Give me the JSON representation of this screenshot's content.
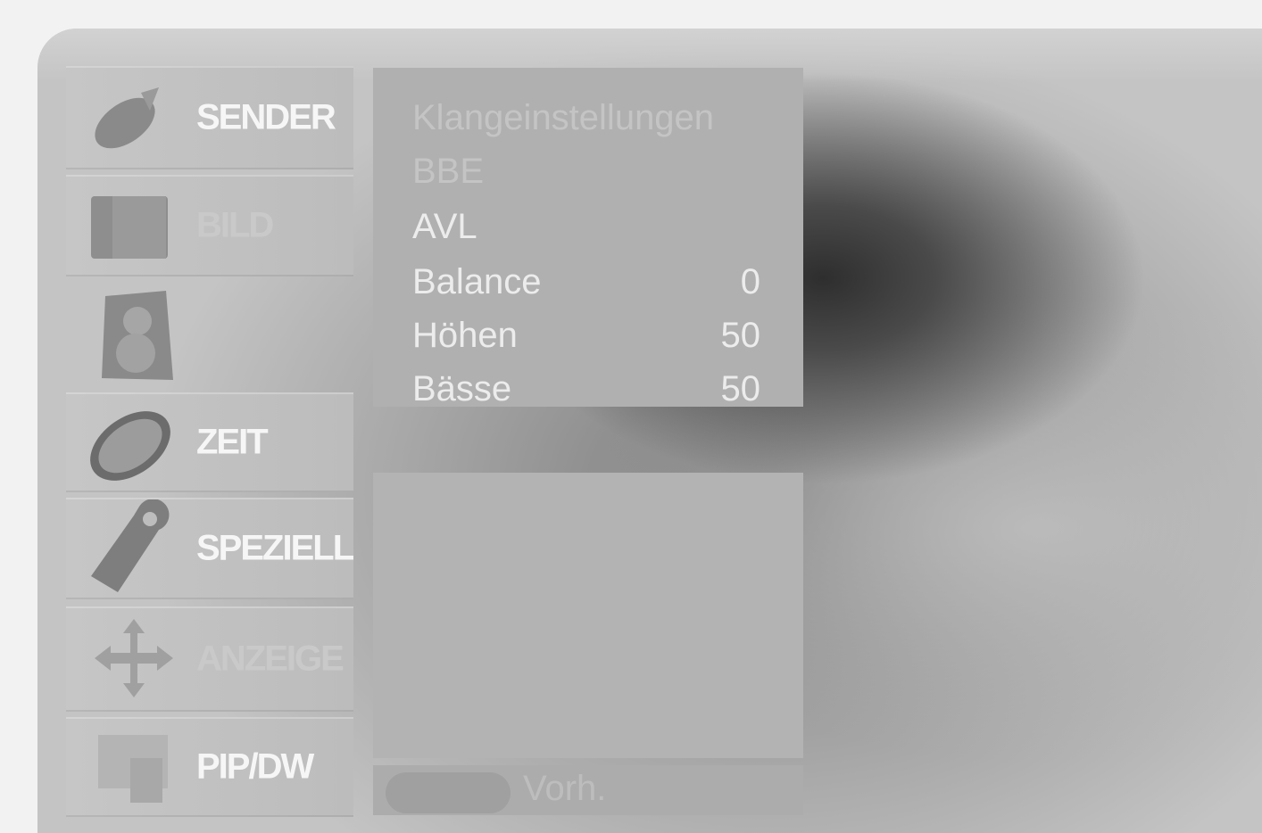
{
  "sidebar": {
    "items": [
      {
        "label": "SENDER",
        "icon": "satellite-dish-icon"
      },
      {
        "label": "BILD",
        "icon": "screen-icon"
      },
      {
        "label": "",
        "icon": "speaker-icon"
      },
      {
        "label": "ZEIT",
        "icon": "clock-icon"
      },
      {
        "label": "SPEZIELL",
        "icon": "tag-icon"
      },
      {
        "label": "ANZEIGE",
        "icon": "move-arrows-icon"
      },
      {
        "label": "PIP/DW",
        "icon": "pip-icon"
      }
    ]
  },
  "sound_menu": {
    "title": "Klangeinstellungen",
    "rows": [
      {
        "label": "BBE",
        "value": ""
      },
      {
        "label": "AVL",
        "value": ""
      },
      {
        "label": "Balance",
        "value": "0"
      },
      {
        "label": "Höhen",
        "value": "50"
      },
      {
        "label": "Bässe",
        "value": "50"
      }
    ]
  },
  "footer": {
    "previous_label": "Vorh."
  }
}
